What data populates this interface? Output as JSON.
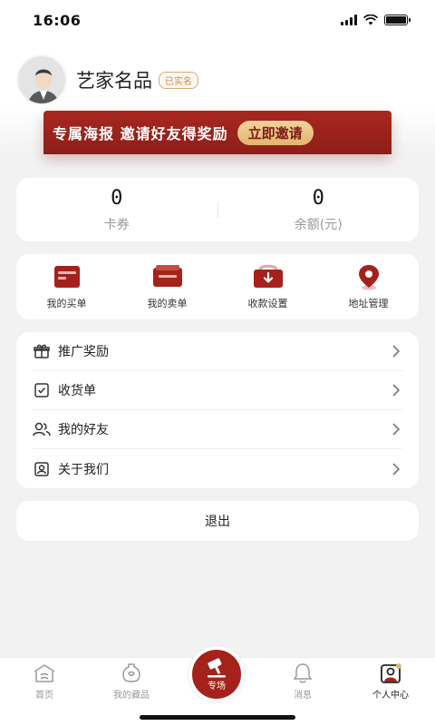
{
  "status_bar": {
    "time": "16:06"
  },
  "profile": {
    "name": "艺家名品",
    "verified_label": "已实名"
  },
  "banner": {
    "text": "专属海报 邀请好友得奖励",
    "button_label": "立即邀请"
  },
  "stats": [
    {
      "value": "0",
      "label": "卡券"
    },
    {
      "value": "0",
      "label": "余额(元)"
    }
  ],
  "quick_actions": [
    {
      "label": "我的买单",
      "icon": "buy-order-icon"
    },
    {
      "label": "我的卖单",
      "icon": "sell-order-icon"
    },
    {
      "label": "收款设置",
      "icon": "payment-settings-icon"
    },
    {
      "label": "地址管理",
      "icon": "location-pin-icon"
    }
  ],
  "menu": [
    {
      "label": "推广奖励",
      "icon": "gift-icon"
    },
    {
      "label": "收货单",
      "icon": "receipt-icon"
    },
    {
      "label": "我的好友",
      "icon": "friends-icon"
    },
    {
      "label": "关于我们",
      "icon": "about-icon"
    }
  ],
  "logout_label": "退出",
  "tabs": [
    {
      "label": "首页",
      "icon": "home-icon"
    },
    {
      "label": "我的藏品",
      "icon": "collection-icon"
    },
    {
      "label": "专场",
      "icon": "auction-hammer-icon"
    },
    {
      "label": "消息",
      "icon": "bell-icon"
    },
    {
      "label": "个人中心",
      "icon": "profile-icon"
    }
  ],
  "colors": {
    "brand_red": "#a4221b",
    "gold": "#e2b56e",
    "background": "#f2f2f2"
  }
}
